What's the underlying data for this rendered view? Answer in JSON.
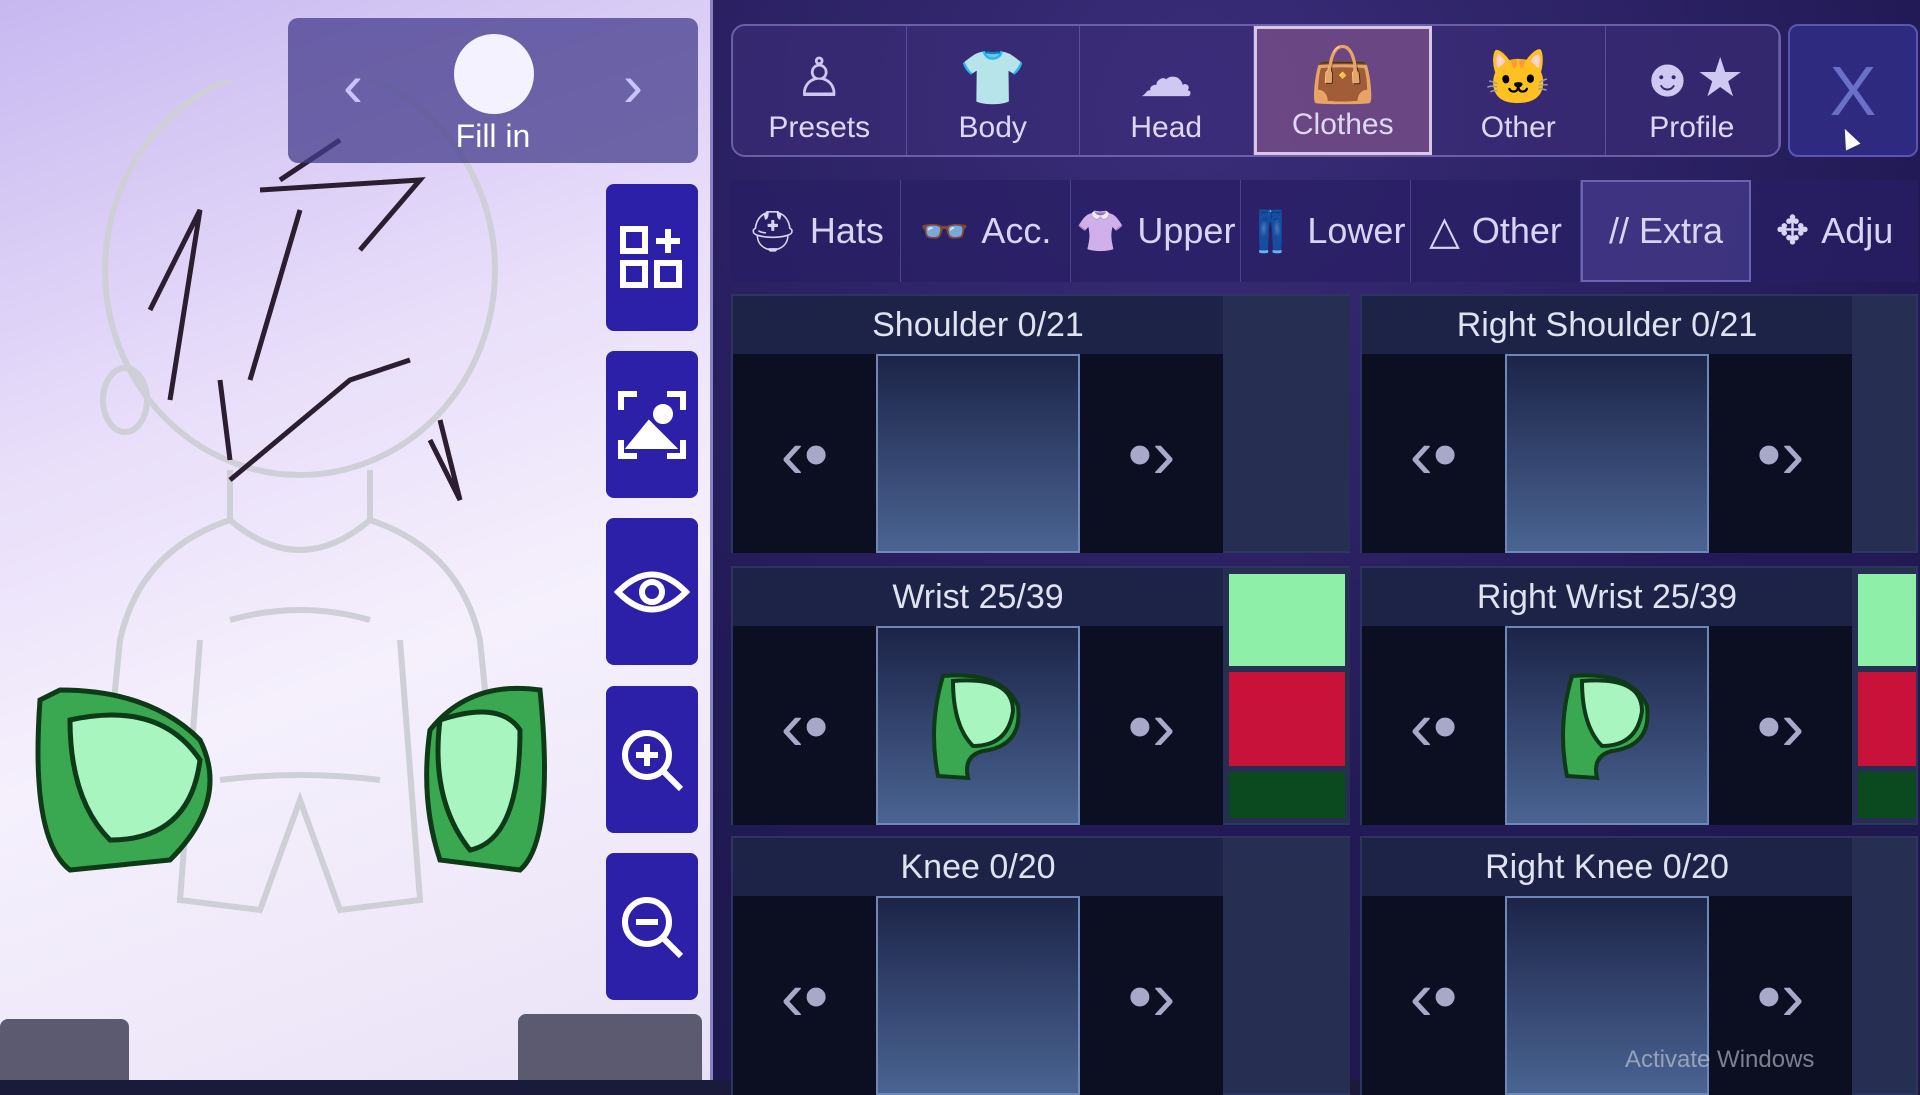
{
  "preview": {
    "nav_label": "Fill in",
    "prev_icon": "chevron-left",
    "next_icon": "chevron-right"
  },
  "side_buttons": [
    {
      "icon": "layout-add-icon"
    },
    {
      "icon": "screenshot-icon"
    },
    {
      "icon": "eye-icon"
    },
    {
      "icon": "zoom-in-icon"
    },
    {
      "icon": "zoom-out-icon"
    }
  ],
  "main_tabs": [
    {
      "label": "Presets",
      "icon": "♙"
    },
    {
      "label": "Body",
      "icon": "👕"
    },
    {
      "label": "Head",
      "icon": "☁"
    },
    {
      "label": "Clothes",
      "icon": "👜",
      "active": true
    },
    {
      "label": "Other",
      "icon": "🐱"
    },
    {
      "label": "Profile",
      "icon": "☻★"
    }
  ],
  "close_label": "X",
  "sub_tabs": [
    {
      "label": "Hats",
      "icon": "⛑"
    },
    {
      "label": "Acc.",
      "icon": "👓"
    },
    {
      "label": "Upper",
      "icon": "👚"
    },
    {
      "label": "Lower",
      "icon": "👖"
    },
    {
      "label": "Other",
      "icon": "△"
    },
    {
      "label": "// Extra",
      "icon": "",
      "active": true
    },
    {
      "label": "Adju",
      "icon": "✥"
    }
  ],
  "slots": [
    {
      "title": "Shoulder 0/21",
      "item": false
    },
    {
      "title": "Right Shoulder 0/21",
      "item": false
    },
    {
      "title": "Wrist 25/39",
      "item": true,
      "colors": [
        "#8ef0a8",
        "#c8123a",
        "#0a4a1e"
      ]
    },
    {
      "title": "Right Wrist 25/39",
      "item": true,
      "colors": [
        "#8ef0a8",
        "#c8123a",
        "#0a4a1e"
      ]
    },
    {
      "title": "Knee 0/20",
      "item": false
    },
    {
      "title": "Right Knee 0/20",
      "item": false
    }
  ],
  "watermark": "Activate Windows"
}
